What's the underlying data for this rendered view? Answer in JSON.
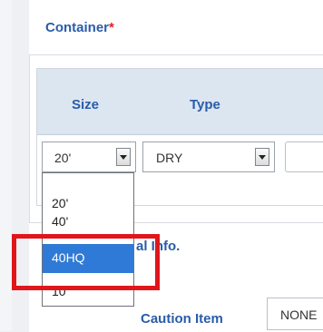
{
  "container_section": {
    "title": "Container",
    "required_mark": "*",
    "columns": [
      "Size",
      "Type"
    ],
    "size_select": {
      "value": "20'"
    },
    "type_select": {
      "value": "DRY"
    },
    "size_options": [
      "20'",
      "40'",
      "40HQ",
      "10'"
    ],
    "highlighted_option": "40HQ"
  },
  "additional_section": {
    "title_visible": "al Info."
  },
  "caution": {
    "label": "Caution Item",
    "value": "NONE"
  },
  "colors": {
    "label_blue": "#2a5ca8",
    "header_bg": "#dce6f1",
    "selected_option": "#2f7ad6",
    "highlight_box": "#e0161c",
    "required": "#e02020"
  }
}
